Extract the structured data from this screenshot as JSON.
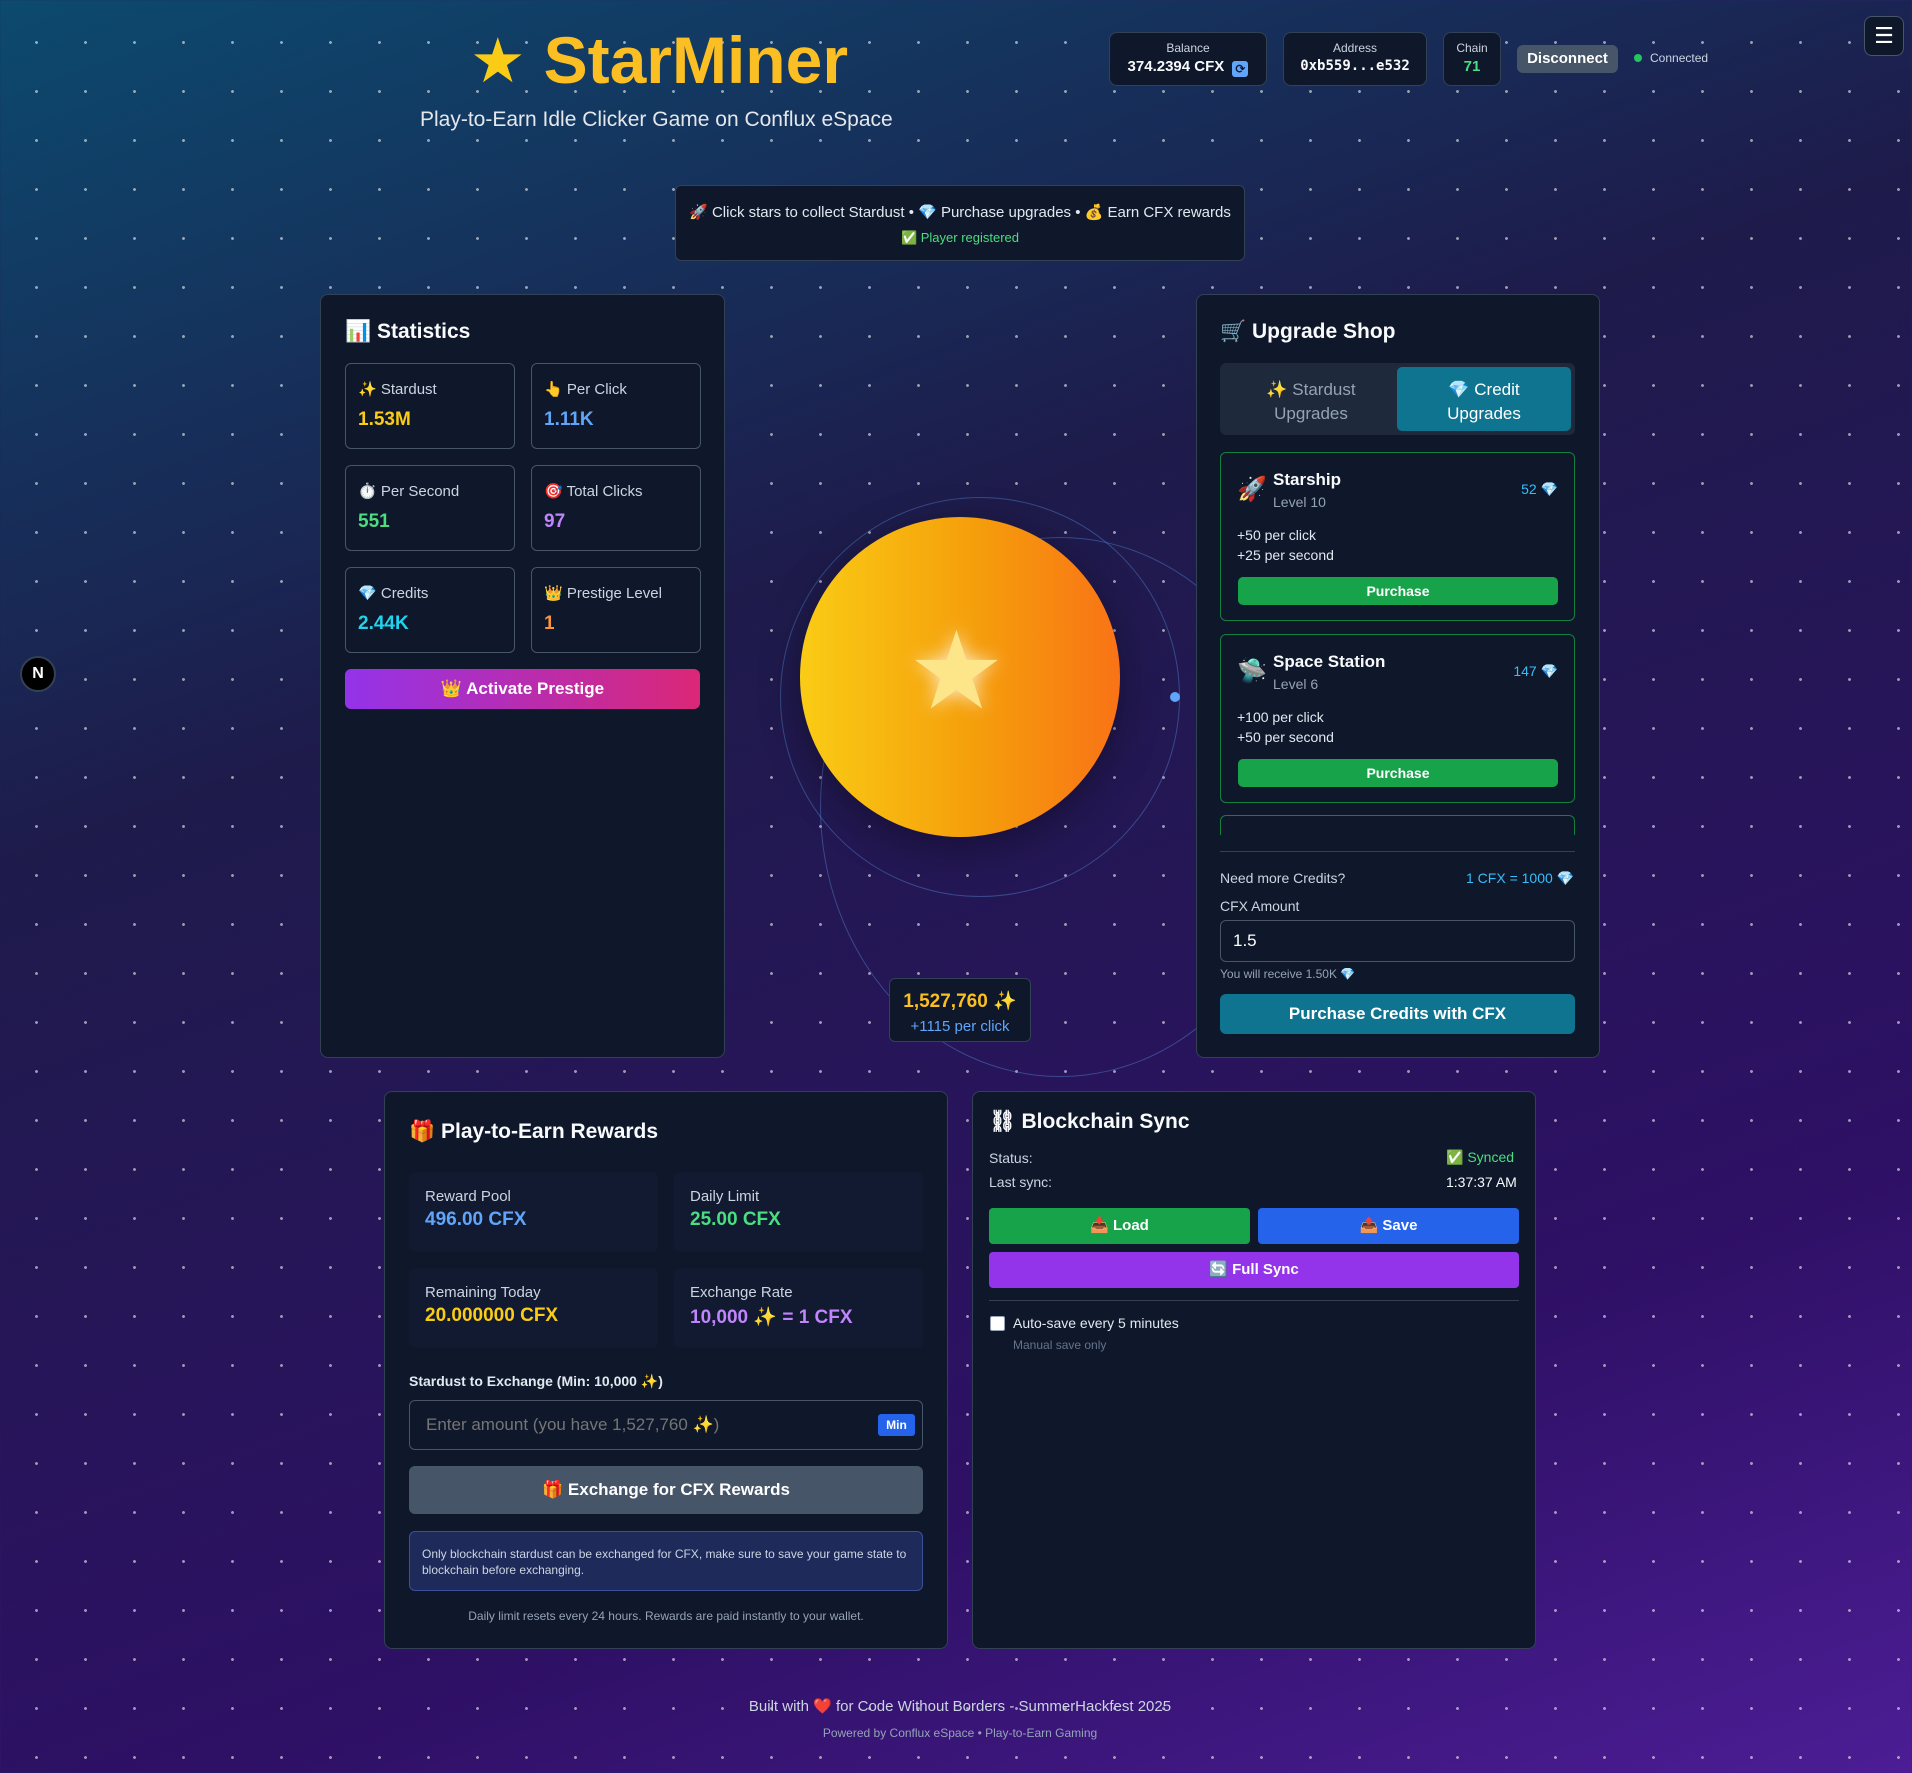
{
  "header": {
    "title": "StarMiner",
    "subtitle": "Play-to-Earn Idle Clicker Game on Conflux eSpace",
    "balance_label": "Balance",
    "balance_value": "374.2394 CFX",
    "address_label": "Address",
    "address_value": "0xb559...e532",
    "chain_label": "Chain",
    "chain_value": "71",
    "disconnect": "Disconnect",
    "status": "Connected"
  },
  "banner": {
    "line1": "🚀 Click stars to collect Stardust • 💎 Purchase upgrades • 💰 Earn CFX rewards",
    "line2": "✅ Player registered"
  },
  "statistics": {
    "title": "📊 Statistics",
    "cards": [
      {
        "icon": "✨",
        "label": "Stardust",
        "value": "1.53M"
      },
      {
        "icon": "👆",
        "label": "Per Click",
        "value": "1.11K"
      },
      {
        "icon": "⏱️",
        "label": "Per Second",
        "value": "551"
      },
      {
        "icon": "🎯",
        "label": "Total Clicks",
        "value": "97"
      },
      {
        "icon": "💎",
        "label": "Credits",
        "value": "2.44K"
      },
      {
        "icon": "👑",
        "label": "Prestige Level",
        "value": "1"
      }
    ],
    "prestige_button": "👑 Activate Prestige"
  },
  "clicker": {
    "count": "1,527,760 ✨",
    "per_click": "+1115 per click"
  },
  "shop": {
    "title": "🛒 Upgrade Shop",
    "tab_stardust_line1": "✨ Stardust",
    "tab_stardust_line2": "Upgrades",
    "tab_credit_line1": "💎 Credit",
    "tab_credit_line2": "Upgrades",
    "upgrades": [
      {
        "icon": "🚀",
        "name": "Starship",
        "level": "Level 10",
        "cost": "52 💎",
        "effect1": "+50 per click",
        "effect2": "+25 per second",
        "button": "Purchase"
      },
      {
        "icon": "🛸",
        "name": "Space Station",
        "level": "Level 6",
        "cost": "147 💎",
        "effect1": "+100 per click",
        "effect2": "+50 per second",
        "button": "Purchase"
      }
    ],
    "need_credits": "Need more Credits?",
    "rate": "1 CFX = 1000 💎",
    "cfx_amount_label": "CFX Amount",
    "cfx_amount_value": "1.5",
    "receive_note": "You will receive 1.50K 💎",
    "purchase_button": "Purchase Credits with CFX"
  },
  "rewards": {
    "title": "🎁 Play-to-Earn Rewards",
    "cards": [
      {
        "label": "Reward Pool",
        "value": "496.00 CFX"
      },
      {
        "label": "Daily Limit",
        "value": "25.00 CFX"
      },
      {
        "label": "Remaining Today",
        "value": "20.000000 CFX"
      },
      {
        "label": "Exchange Rate",
        "value": "10,000 ✨ = 1 CFX"
      }
    ],
    "input_label": "Stardust to Exchange (Min: 10,000 ✨)",
    "input_placeholder": "Enter amount (you have 1,527,760 ✨)",
    "min_button": "Min",
    "exchange_button": "🎁 Exchange for CFX Rewards",
    "note": "Only blockchain stardust can be exchanged for CFX, make sure to save your game state to blockchain before exchanging.",
    "footnote": "Daily limit resets every 24 hours. Rewards are paid instantly to your wallet."
  },
  "sync": {
    "title": "⛓ Blockchain Sync",
    "status_label": "Status:",
    "status_value": "✅ Synced",
    "last_sync_label": "Last sync:",
    "last_sync_value": "1:37:37 AM",
    "load_button": "📥 Load",
    "save_button": "📤 Save",
    "full_sync_button": "🔄 Full Sync",
    "autosave_label": "Auto-save every 5 minutes",
    "autosave_note": "Manual save only"
  },
  "footer": {
    "line1": "Built with ❤️ for Code Without Borders - SummerHackfest 2025",
    "line2": "Powered by Conflux eSpace • Play-to-Earn Gaming"
  },
  "colors": {
    "accent_gold": "#fbbf24",
    "accent_cyan": "#0e7490",
    "success": "#16a34a",
    "info": "#2563eb",
    "purple": "#9333ea"
  }
}
